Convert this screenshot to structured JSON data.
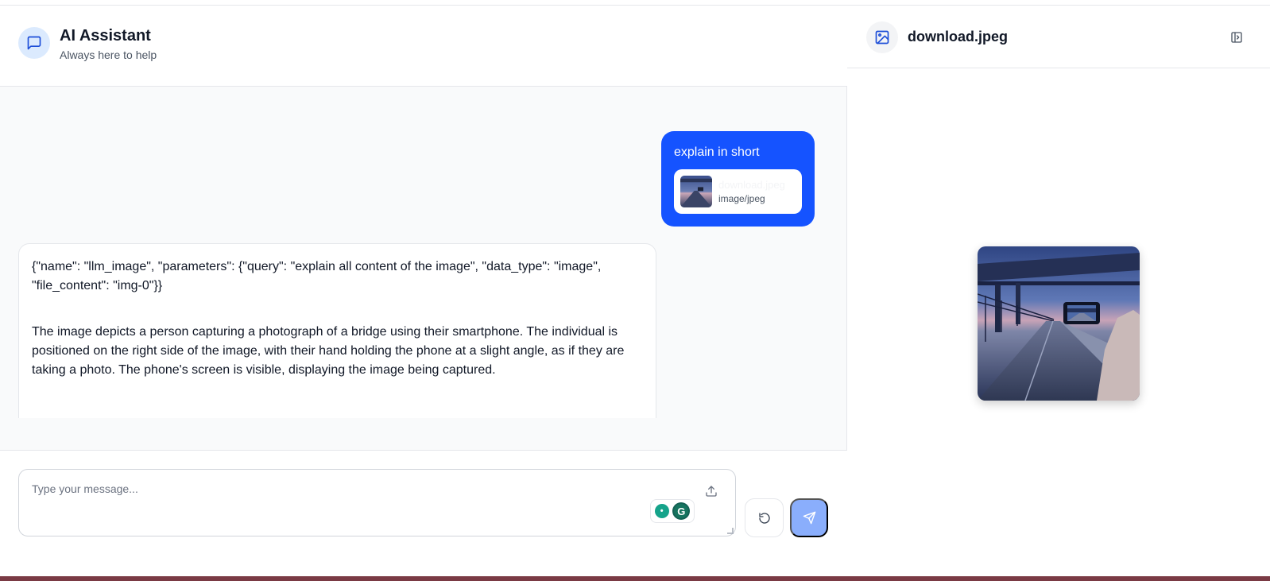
{
  "header": {
    "title": "AI Assistant",
    "subtitle": "Always here to help"
  },
  "messages": [
    {
      "role": "user",
      "text": "explain in short",
      "attachment": {
        "name": "download.jpeg",
        "type": "image/jpeg"
      }
    },
    {
      "role": "assistant",
      "paragraphs": [
        "{\"name\": \"llm_image\", \"parameters\": {\"query\": \"explain all content of the image\", \"data_type\": \"image\", \"file_content\": \"img-0\"}}",
        "The image depicts a person capturing a photograph of a bridge using their smartphone. The individual is positioned on the right side of the image, with their hand holding the phone at a slight angle, as if they are taking a photo. The phone's screen is visible, displaying the image being captured."
      ]
    }
  ],
  "composer": {
    "placeholder": "Type your message..."
  },
  "preview": {
    "filename": "download.jpeg"
  },
  "colors": {
    "accent": "#1553ff",
    "send_disabled": "#8aaefc",
    "header_icon_bg": "#dbeafe"
  },
  "icons": {
    "header": "chat-bubble-icon",
    "upload": "upload-icon",
    "reset": "rotate-ccw-icon",
    "send": "send-icon",
    "preview": "image-icon",
    "collapse": "panel-collapse-icon"
  }
}
